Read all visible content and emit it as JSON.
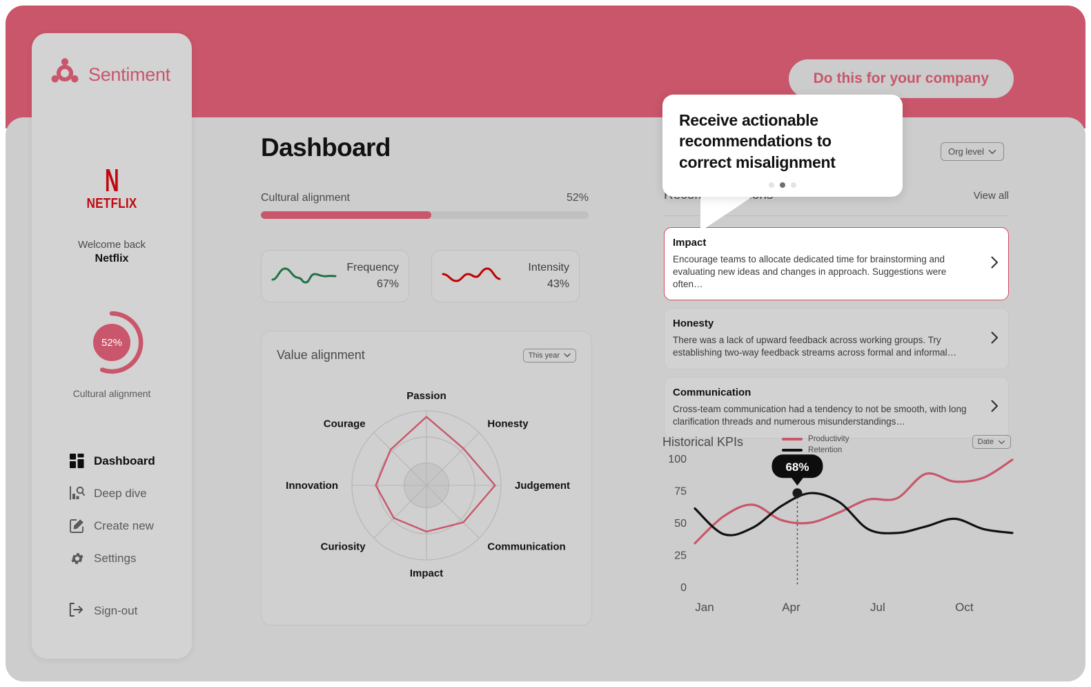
{
  "brand": {
    "name": "Sentiment",
    "logo_icon": "sentiment-logo-icon",
    "accent": "#c9566a"
  },
  "header": {
    "cta_label": "Do this for your company"
  },
  "sidebar": {
    "company_logo": "netflix-logo",
    "company_mark": "N",
    "company_wordmark": "NETFLIX",
    "welcome_label": "Welcome back",
    "company_name": "Netflix",
    "gauge": {
      "value_label": "52%",
      "caption": "Cultural alignment",
      "percent": 52
    },
    "nav": [
      {
        "label": "Dashboard",
        "icon": "grid-icon",
        "active": true
      },
      {
        "label": "Deep dive",
        "icon": "analytics-person-icon",
        "active": false
      },
      {
        "label": "Create new",
        "icon": "edit-square-icon",
        "active": false
      },
      {
        "label": "Settings",
        "icon": "gear-icon",
        "active": false
      }
    ],
    "signout": {
      "label": "Sign-out",
      "icon": "sign-out-icon"
    }
  },
  "main": {
    "page_title": "Dashboard",
    "cultural_alignment": {
      "label": "Cultural alignment",
      "value_label": "52%",
      "percent": 52
    },
    "metrics": [
      {
        "name": "Frequency",
        "value_label": "67%",
        "spark_color": "#1e7145",
        "icon": "sparkline-icon"
      },
      {
        "name": "Intensity",
        "value_label": "43%",
        "spark_color": "#c00000",
        "icon": "sparkline-icon"
      }
    ],
    "value_alignment": {
      "title": "Value alignment",
      "period_select": {
        "value": "This year",
        "icon": "chevron-down-icon"
      }
    },
    "org_select": {
      "value": "Org level",
      "icon": "chevron-down-icon"
    }
  },
  "recommendations": {
    "title": "Recommendations",
    "view_all_label": "View all",
    "items": [
      {
        "name": "Impact",
        "description": "Encourage teams to allocate dedicated time for brainstorming and evaluating new ideas and changes in approach. Suggestions were often…",
        "selected": true,
        "icon": "chevron-right-icon"
      },
      {
        "name": "Honesty",
        "description": "There was a lack of upward feedback across working groups. Try establishing two-way feedback streams across formal and informal…",
        "selected": false,
        "icon": "chevron-right-icon"
      },
      {
        "name": "Communication",
        "description": "Cross-team communication had a tendency to not be smooth, with long clarification threads and numerous misunderstandings…",
        "selected": false,
        "icon": "chevron-right-icon"
      }
    ]
  },
  "kpi": {
    "title": "Historical KPIs",
    "date_select": {
      "value": "Date",
      "icon": "chevron-down-icon"
    },
    "tooltip_label": "68%"
  },
  "callout": {
    "text": "Receive actionable recommendations to correct misalignment",
    "dots_total": 3,
    "dot_active_index": 1
  },
  "chart_data": [
    {
      "type": "radar",
      "title": "Value alignment",
      "categories": [
        "Passion",
        "Honesty",
        "Judgement",
        "Communication",
        "Impact",
        "Curiosity",
        "Innovation",
        "Courage"
      ],
      "values": [
        92,
        70,
        92,
        70,
        62,
        62,
        68,
        68
      ],
      "rmax": 100,
      "rings": [
        30,
        65,
        100
      ],
      "series_color": "#c9566a",
      "grid": true,
      "legend": "none"
    },
    {
      "type": "line",
      "title": "Historical KPIs",
      "x": [
        "Jan",
        "Feb",
        "Mar",
        "Apr",
        "May",
        "Jun",
        "Jul",
        "Aug",
        "Sep",
        "Oct",
        "Nov",
        "Dec"
      ],
      "xtick_labels": [
        "Jan",
        "Apr",
        "Jul",
        "Oct"
      ],
      "ytick_labels": [
        "0",
        "25",
        "50",
        "75",
        "100"
      ],
      "ylim": [
        0,
        100
      ],
      "ylabel": "",
      "xlabel": "",
      "grid": false,
      "legend": "top",
      "annotation": {
        "label": "68%",
        "x": "Mar",
        "y": 73,
        "series": "Retention"
      },
      "series": [
        {
          "name": "Productivity",
          "color": "#c9566a",
          "values": [
            34,
            55,
            64,
            52,
            50,
            58,
            68,
            69,
            88,
            82,
            85,
            99
          ]
        },
        {
          "name": "Retention",
          "color": "#111111",
          "values": [
            61,
            41,
            46,
            63,
            73,
            66,
            45,
            42,
            47,
            53,
            45,
            42
          ]
        }
      ]
    }
  ]
}
